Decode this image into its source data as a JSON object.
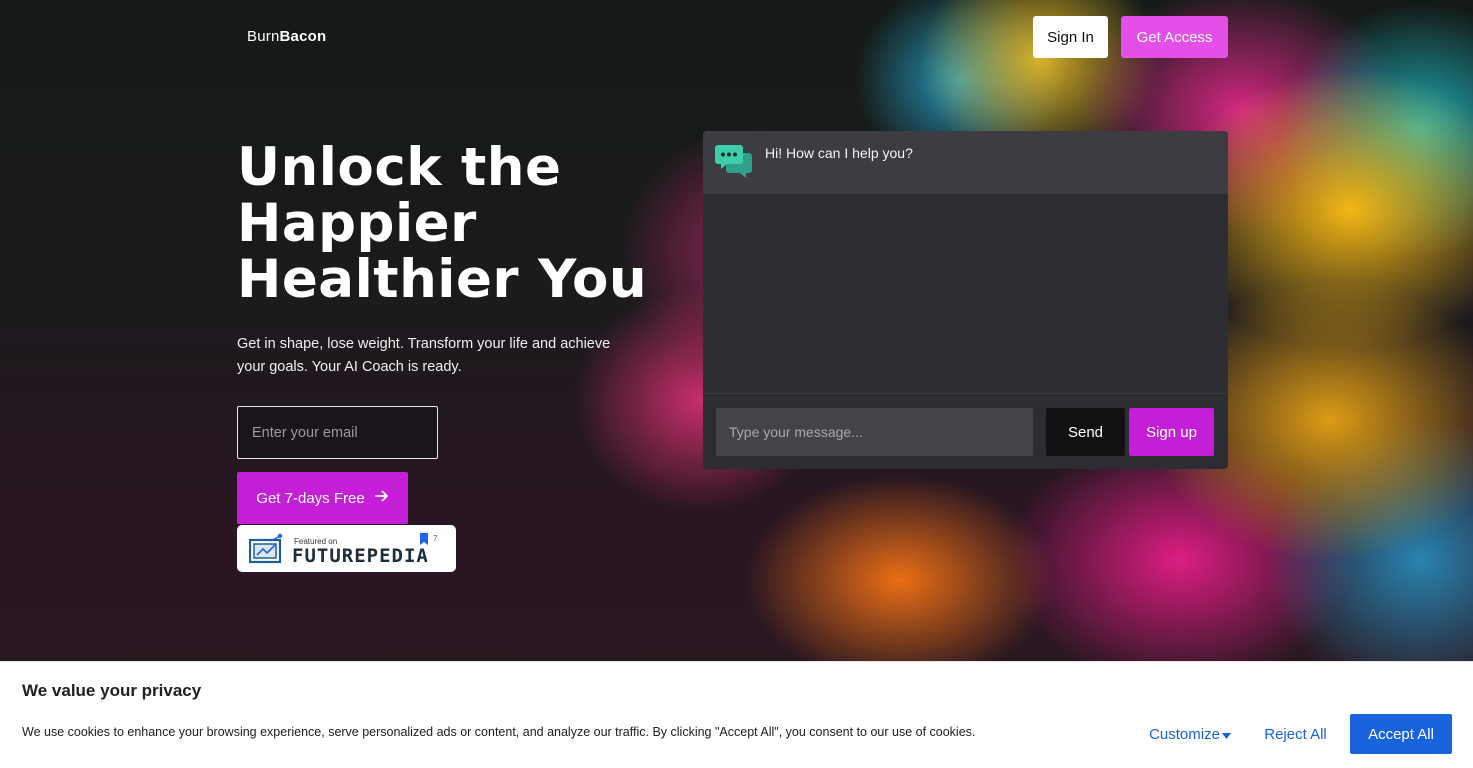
{
  "header": {
    "logo_light": "Burn",
    "logo_bold": "Bacon",
    "signin_label": "Sign In",
    "access_label": "Get Access"
  },
  "hero": {
    "title_lines": [
      "Unlock the",
      "Happier",
      "Healthier You"
    ],
    "subtitle": "Get in shape, lose weight. Transform your life and achieve your goals. Your AI Coach is ready.",
    "email_placeholder": "Enter your email",
    "cta_label": "Get 7-days Free",
    "cta_icon": "arrow-right-icon"
  },
  "badge": {
    "small_text": "Featured on",
    "big_text": "FUTUREPEDIA",
    "count": "7"
  },
  "chat": {
    "greeting": "Hi! How can I help you?",
    "input_placeholder": "Type your message...",
    "send_label": "Send",
    "signup_label": "Sign up",
    "avatar_icon": "chat-bubbles-icon"
  },
  "cookie": {
    "title": "We value your privacy",
    "text": "We use cookies to enhance your browsing experience, serve personalized ads or content, and analyze our traffic. By clicking \"Accept All\", you consent to our use of cookies.",
    "customize_label": "Customize",
    "reject_label": "Reject All",
    "accept_label": "Accept All"
  },
  "colors": {
    "accent_magenta": "#c41fd6",
    "accent_pink": "#e44fe8",
    "cookie_blue": "#1863dc"
  }
}
